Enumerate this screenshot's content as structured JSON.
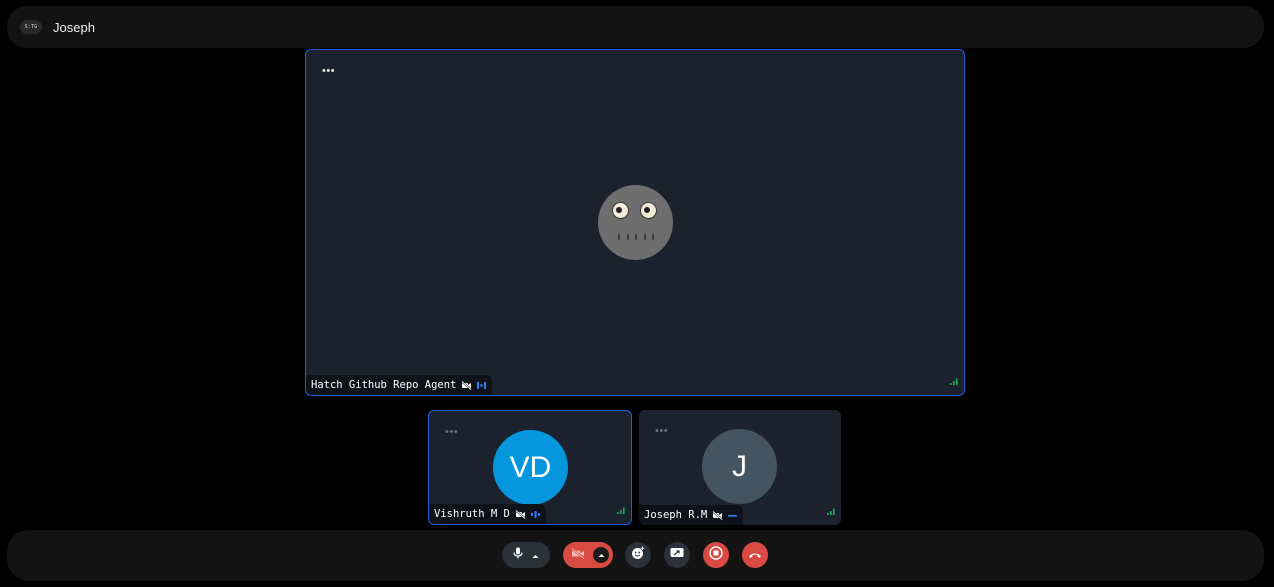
{
  "header": {
    "logo_text": "S:TG",
    "user_name": "Joseph"
  },
  "main_tile": {
    "participant_name": "Hatch Github Repo Agent",
    "menu_glyph": "•••",
    "audio_level": "speaking"
  },
  "participants": [
    {
      "name": "Vishruth M D",
      "initials": "VD",
      "avatar_color": "#0596de",
      "menu_glyph": "•••"
    },
    {
      "name": "Joseph R.M",
      "initials": "J",
      "avatar_color": "#455461",
      "menu_glyph": "•••"
    }
  ],
  "colors": {
    "accent": "#1f5fd6",
    "danger": "#d94a43",
    "signal": "#1fb35a",
    "background": "#000000"
  },
  "controls": [
    {
      "name": "microphone",
      "icon": "mic-icon"
    },
    {
      "name": "camera",
      "icon": "camera-off-icon",
      "state": "off"
    },
    {
      "name": "reactions",
      "icon": "emoji-icon"
    },
    {
      "name": "share-screen",
      "icon": "screen-share-icon"
    },
    {
      "name": "record",
      "icon": "record-icon"
    },
    {
      "name": "leave-call",
      "icon": "hang-up-icon"
    }
  ]
}
